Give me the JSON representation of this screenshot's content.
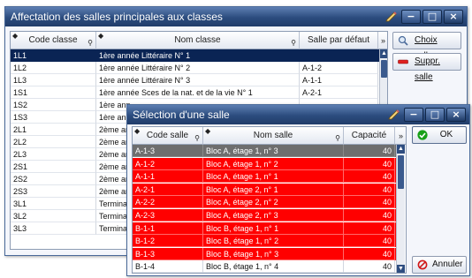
{
  "win1": {
    "title": "Affectation des salles principales aux classes",
    "headers": {
      "code": "Code classe",
      "nom": "Nom classe",
      "salle": "Salle par défaut"
    },
    "rows": [
      {
        "code": "1L1",
        "nom": "1ère année Littéraire N° 1",
        "salle": ""
      },
      {
        "code": "1L2",
        "nom": "1ère année Littéraire N° 2",
        "salle": "A-1-2"
      },
      {
        "code": "1L3",
        "nom": "1ère année Littéraire N° 3",
        "salle": "A-1-1"
      },
      {
        "code": "1S1",
        "nom": "1ère année Sces de la nat. et de la vie N° 1",
        "salle": "A-2-1"
      },
      {
        "code": "1S2",
        "nom": "1ère ann",
        "salle": ""
      },
      {
        "code": "1S3",
        "nom": "1ère ann",
        "salle": ""
      },
      {
        "code": "2L1",
        "nom": "2ème an",
        "salle": ""
      },
      {
        "code": "2L2",
        "nom": "2ème an",
        "salle": ""
      },
      {
        "code": "2L3",
        "nom": "2ème an",
        "salle": ""
      },
      {
        "code": "2S1",
        "nom": "2ème an",
        "salle": ""
      },
      {
        "code": "2S2",
        "nom": "2ème an",
        "salle": ""
      },
      {
        "code": "2S3",
        "nom": "2ème an",
        "salle": ""
      },
      {
        "code": "3L1",
        "nom": "Terminal",
        "salle": ""
      },
      {
        "code": "3L2",
        "nom": "Terminal",
        "salle": ""
      },
      {
        "code": "3L3",
        "nom": "Terminal",
        "salle": ""
      }
    ],
    "buttons": {
      "choix": "Choix salle",
      "suppr": "Suppr. salle"
    }
  },
  "win2": {
    "title": "Sélection d'une salle",
    "headers": {
      "code": "Code salle",
      "nom": "Nom salle",
      "cap": "Capacité"
    },
    "rows": [
      {
        "code": "A-1-3",
        "nom": "Bloc A, étage 1, n° 3",
        "cap": "40",
        "state": "selected"
      },
      {
        "code": "A-1-2",
        "nom": "Bloc A, étage 1, n° 2",
        "cap": "40",
        "state": "red"
      },
      {
        "code": "A-1-1",
        "nom": "Bloc A, étage 1, n° 1",
        "cap": "40",
        "state": "red"
      },
      {
        "code": "A-2-1",
        "nom": "Bloc A, étage 2, n° 1",
        "cap": "40",
        "state": "red"
      },
      {
        "code": "A-2-2",
        "nom": "Bloc A, étage 2, n° 2",
        "cap": "40",
        "state": "red"
      },
      {
        "code": "A-2-3",
        "nom": "Bloc A, étage 2, n° 3",
        "cap": "40",
        "state": "red"
      },
      {
        "code": "B-1-1",
        "nom": "Bloc B, étage 1, n° 1",
        "cap": "40",
        "state": "red"
      },
      {
        "code": "B-1-2",
        "nom": "Bloc B, étage 1, n° 2",
        "cap": "40",
        "state": "red"
      },
      {
        "code": "B-1-3",
        "nom": "Bloc B, étage 1, n° 3",
        "cap": "40",
        "state": "red"
      },
      {
        "code": "B-1-4",
        "nom": "Bloc B, étage 1, n° 4",
        "cap": "40",
        "state": "normal"
      }
    ],
    "buttons": {
      "ok": "OK",
      "annuler": "Annuler"
    }
  },
  "colors": {
    "selected_row": "#0a2454",
    "red_row": "#ff0000",
    "title_bar": "#2c4c7e"
  }
}
